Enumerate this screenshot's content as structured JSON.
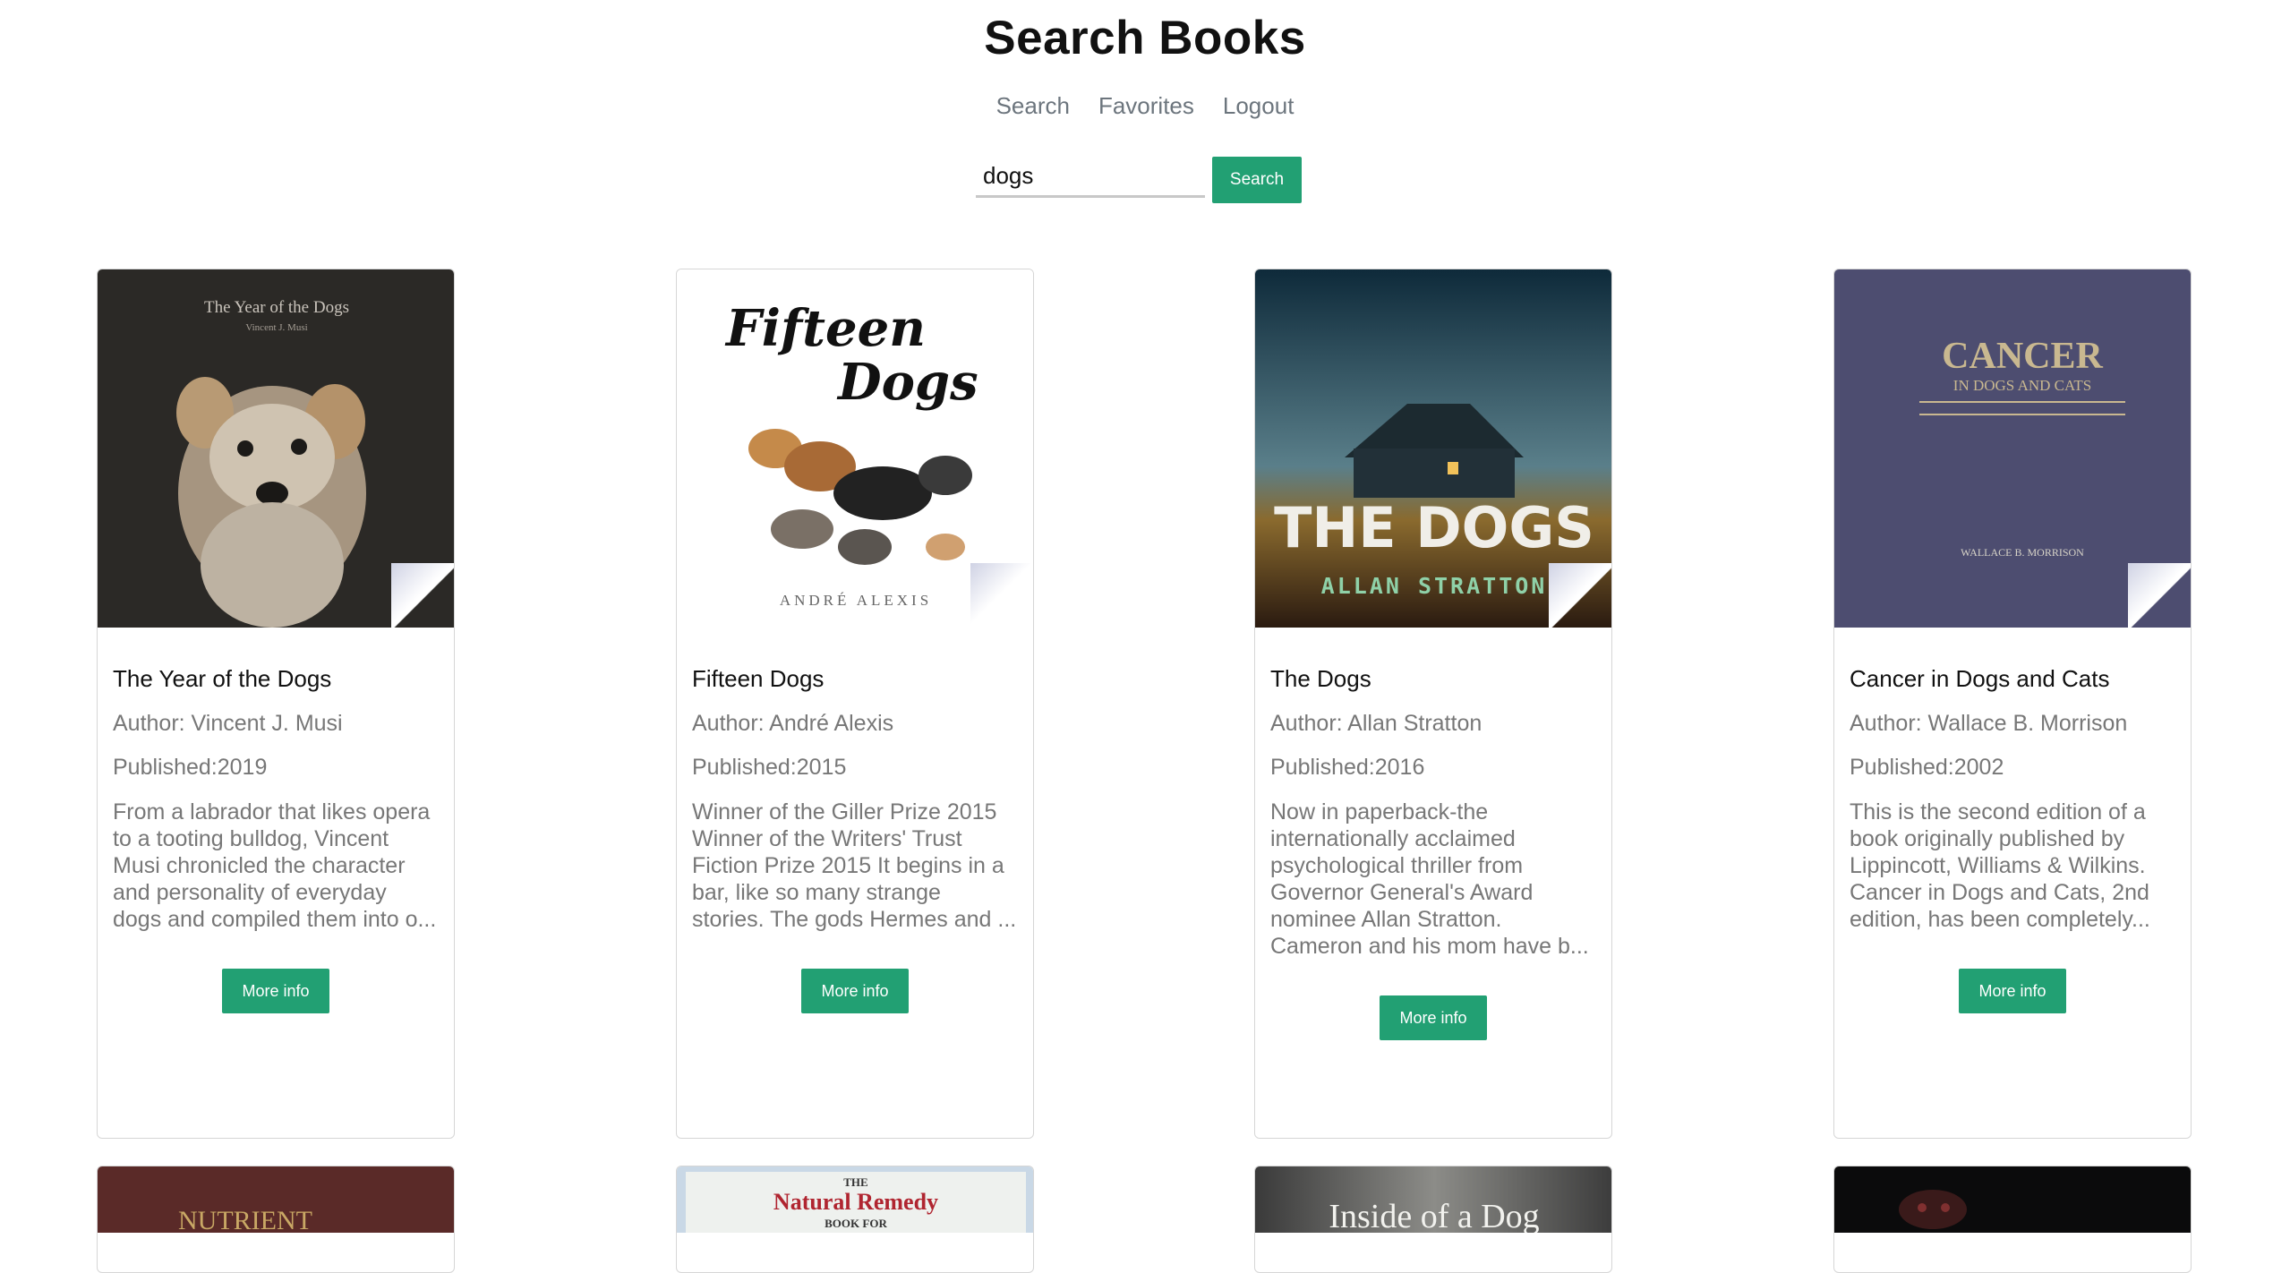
{
  "header": {
    "title": "Search Books"
  },
  "nav": {
    "items": [
      "Search",
      "Favorites",
      "Logout"
    ]
  },
  "search": {
    "value": "dogs",
    "button": "Search"
  },
  "books": [
    {
      "title": "The Year of the Dogs",
      "author": "Author: Vincent J. Musi",
      "published": "Published:2019",
      "description": "From a labrador that likes opera to a tooting bulldog, Vincent Musi chronicled the character and personality of everyday dogs and compiled them into o...",
      "button": "More info",
      "cover_text": [
        "The Year of the Dogs",
        "Vincent J. Musi"
      ]
    },
    {
      "title": "Fifteen Dogs",
      "author": "Author: André Alexis",
      "published": "Published:2015",
      "description": "Winner of the Giller Prize 2015 Winner of the Writers' Trust Fiction Prize 2015 It begins in a bar, like so many strange stories. The gods Hermes and ...",
      "button": "More info",
      "cover_text": [
        "Fifteen",
        "Dogs",
        "ANDRÉ ALEXIS"
      ]
    },
    {
      "title": "The Dogs",
      "author": "Author: Allan Stratton",
      "published": "Published:2016",
      "description": "Now in paperback-the internationally acclaimed psychological thriller from Governor General's Award nominee Allan Stratton. Cameron and his mom have b...",
      "button": "More info",
      "cover_text": [
        "THE DOGS",
        "ALLAN STRATTON"
      ]
    },
    {
      "title": "Cancer in Dogs and Cats",
      "author": "Author: Wallace B. Morrison",
      "published": "Published:2002",
      "description": "This is the second edition of a book originally published by Lippincott, Williams & Wilkins. Cancer in Dogs and Cats, 2nd edition, has been completely...",
      "button": "More info",
      "cover_text": [
        "CANCER",
        "IN DOGS AND CATS",
        "WALLACE B. MORRISON"
      ]
    }
  ],
  "next_row": [
    {
      "cover_text": "NUTRIENT"
    },
    {
      "cover_text": [
        "THE",
        "Natural Remedy",
        "BOOK FOR"
      ]
    },
    {
      "cover_text": "Inside of a Dog"
    },
    {
      "cover_text": ""
    }
  ]
}
